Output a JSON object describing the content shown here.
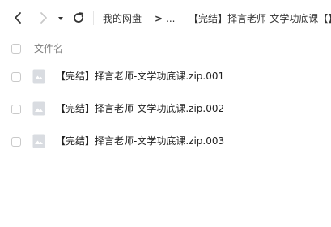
{
  "toolbar": {
    "back_icon": "chevron-left-icon",
    "forward_icon": "chevron-right-icon",
    "history_icon": "caret-down-icon",
    "refresh_icon": "refresh-icon"
  },
  "breadcrumb": {
    "root": "我的网盘",
    "separator": ">",
    "ellipsis": "...",
    "current": "【完结】择言老师-文学功底课【】"
  },
  "list_header": {
    "column_name": "文件名"
  },
  "files": [
    {
      "name": "【完结】择言老师-文学功底课.zip.001",
      "icon": "archive-file-icon"
    },
    {
      "name": "【完结】择言老师-文学功底课.zip.002",
      "icon": "archive-file-icon"
    },
    {
      "name": "【完结】择言老师-文学功底课.zip.003",
      "icon": "archive-file-icon"
    }
  ],
  "colors": {
    "icon_active": "#333333",
    "icon_disabled": "#c8c8c8",
    "muted_text": "#808080",
    "file_icon": "#d9dce1"
  }
}
